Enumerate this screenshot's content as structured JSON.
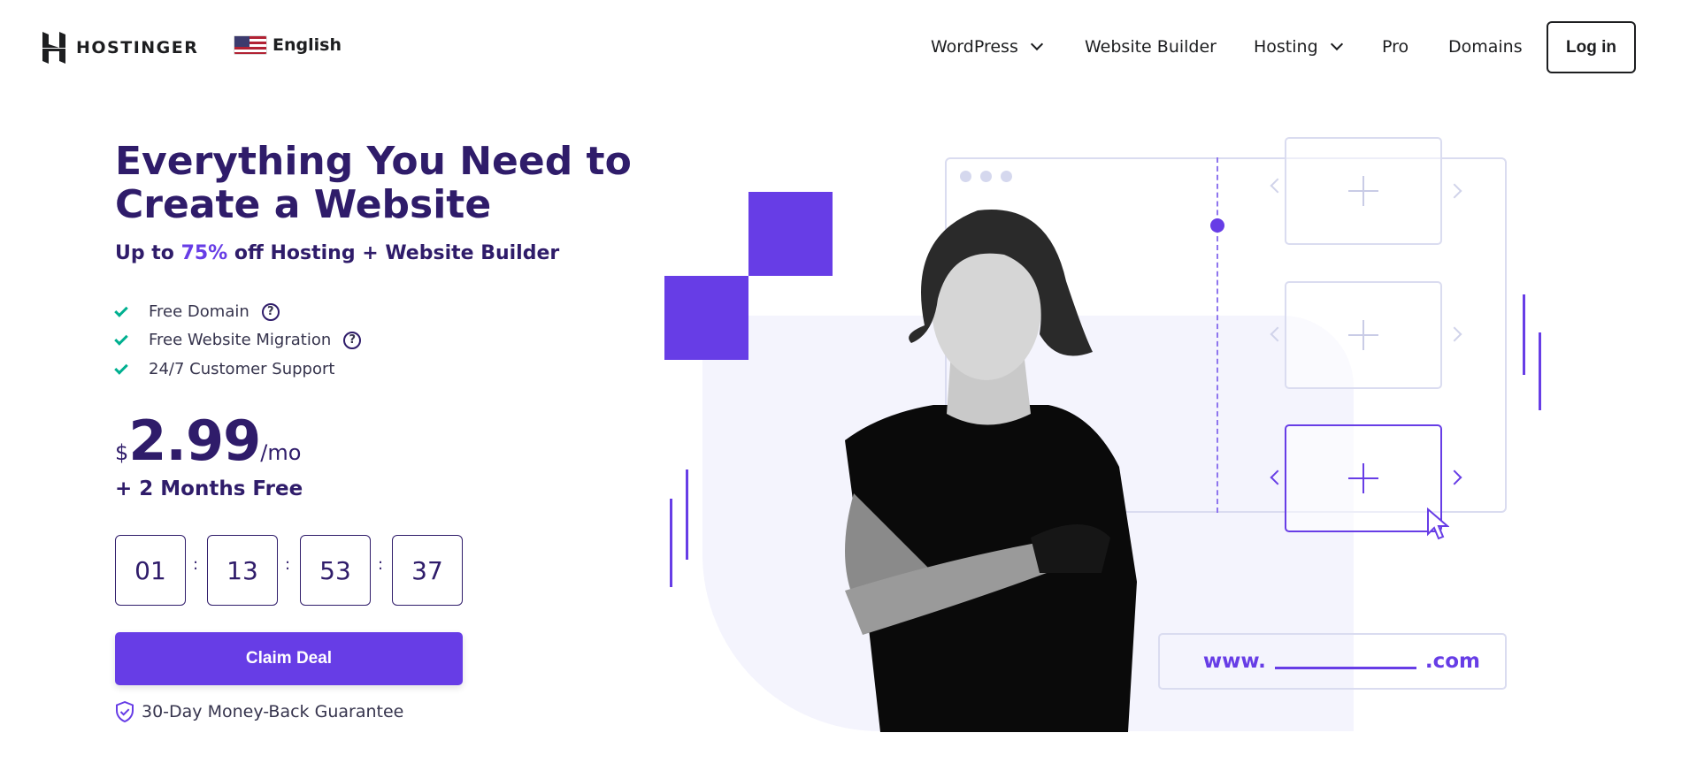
{
  "header": {
    "brand": "HOSTINGER",
    "language": "English",
    "nav": [
      {
        "label": "WordPress",
        "dropdown": true
      },
      {
        "label": "Website Builder",
        "dropdown": false
      },
      {
        "label": "Hosting",
        "dropdown": true
      },
      {
        "label": "Pro",
        "dropdown": false
      },
      {
        "label": "Domains",
        "dropdown": false
      }
    ],
    "login_label": "Log in"
  },
  "hero": {
    "title_line1": "Everything You Need to",
    "title_line2": "Create a Website",
    "subtitle_prefix": "Up to ",
    "subtitle_highlight": "75%",
    "subtitle_suffix": " off Hosting + Website Builder",
    "features": [
      {
        "label": "Free Domain",
        "help": true
      },
      {
        "label": "Free Website Migration",
        "help": true
      },
      {
        "label": "24/7 Customer Support",
        "help": false
      }
    ],
    "help_glyph": "?",
    "price_currency": "$",
    "price_amount": "2.99",
    "price_period": "/mo",
    "bonus": "+ 2 Months Free",
    "countdown": [
      "01",
      "13",
      "53",
      "37"
    ],
    "countdown_separator": ":",
    "cta_label": "Claim Deal",
    "guarantee": "30-Day Money-Back Guarantee"
  },
  "illustration": {
    "url_prefix": "www.",
    "url_suffix": ".com"
  },
  "colors": {
    "accent": "#673de6",
    "heading": "#2f1c6a",
    "check": "#00b090"
  }
}
